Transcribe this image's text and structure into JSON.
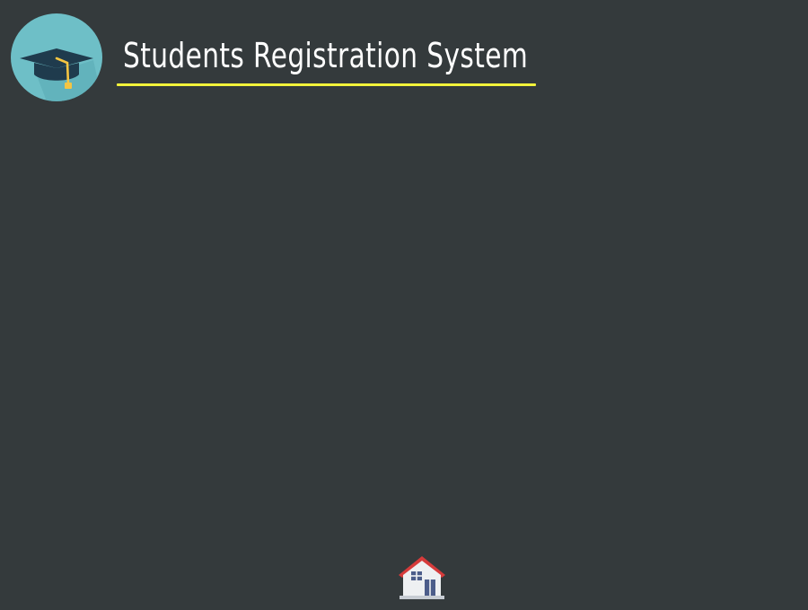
{
  "app": {
    "title": "Students Registration System",
    "logo_icon": "graduation-cap-icon",
    "home_icon": "house-icon"
  },
  "colors": {
    "background": "#343a3c",
    "title_text": "#ffffff",
    "title_underline": "#f2f23a",
    "logo_circle": "#6ebfc7",
    "cap": "#1f3b4d",
    "tassel": "#f4c542",
    "house_roof": "#d63b3b",
    "house_wall": "#eef0f2",
    "house_window": "#4c5d8a"
  }
}
